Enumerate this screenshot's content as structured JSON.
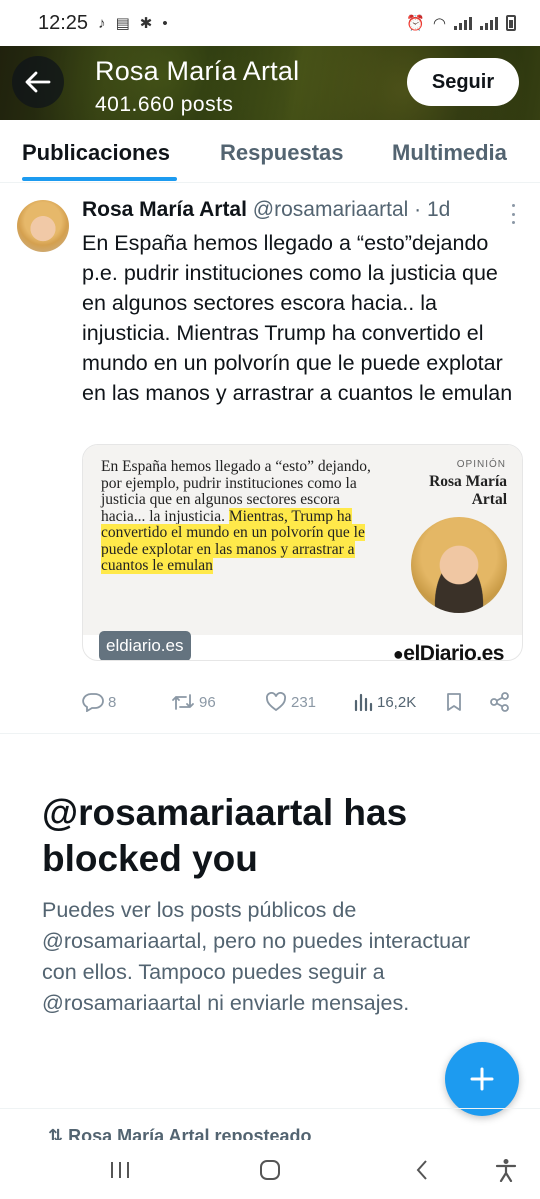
{
  "status_bar": {
    "time": "12:25"
  },
  "header": {
    "title": "Rosa María Artal",
    "post_count": "401.660 posts",
    "follow_label": "Seguir"
  },
  "tabs": [
    {
      "label": "Publicaciones",
      "active": true
    },
    {
      "label": "Respuestas",
      "active": false
    },
    {
      "label": "Multimedia",
      "active": false
    }
  ],
  "tweet": {
    "name": "Rosa María Artal",
    "handle": "@rosamariaartal",
    "time": "· 1d",
    "text": "En España hemos llegado a “esto”dejando p.e. pudrir instituciones como la justicia que en algunos sectores escora hacia.. la injusticia. Mientras Trump ha convertido el mundo en un polvorín que le puede explotar en las manos y arrastrar a cuantos le emulan",
    "card": {
      "quote_plain": "En España hemos llegado a “esto” dejando, por ejemplo, pudrir instituciones como la justicia que en algunos sectores escora hacia... la injusticia. ",
      "quote_highlight": "Mientras, Trump ha convertido el mundo en un polvorín que le puede explotar en las manos y arrastrar a cuantos le emulan",
      "label": "OPINIÓN",
      "author": "Rosa María Artal",
      "domain_badge": "eldiario.es",
      "logo_text": "elDiario.es"
    },
    "actions": {
      "replies": "8",
      "retweets": "96",
      "likes": "231",
      "views": "16,2K"
    }
  },
  "blocked": {
    "title": "@rosamariaartal has blocked you",
    "description": "Puedes ver los posts públicos de @rosamariaartal, pero no puedes interactuar con ellos. Tampoco puedes seguir a @rosamariaartal ni enviarle mensajes."
  },
  "next_item": {
    "repost_text": "Rosa María Artal reposteado"
  },
  "colors": {
    "accent": "#1d9bf0",
    "text": "#0f1419",
    "muted": "#536471",
    "highlight": "#ffe94a"
  }
}
